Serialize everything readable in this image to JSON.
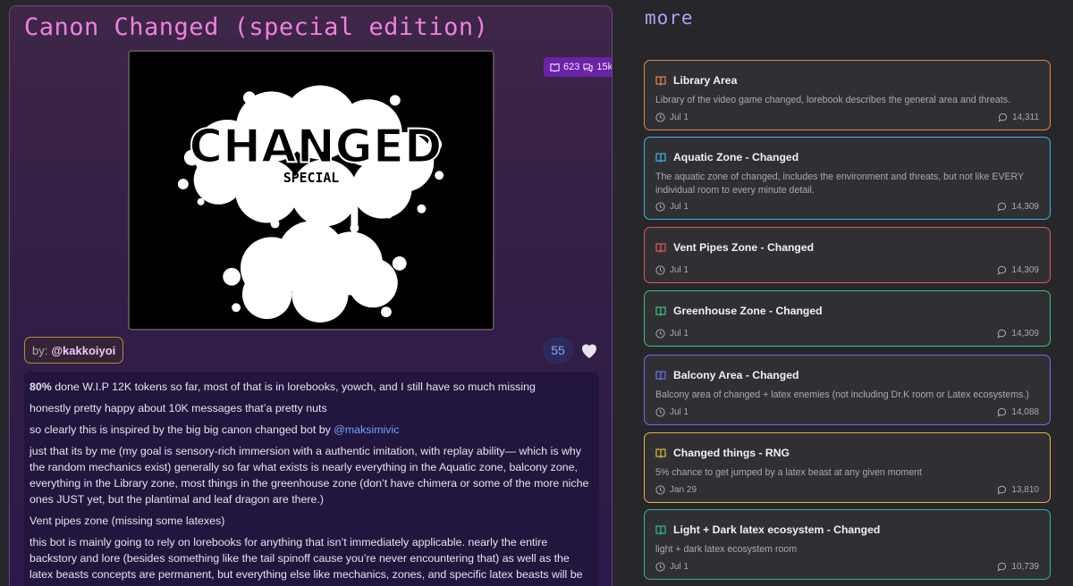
{
  "bot": {
    "title": "Canon Changed (special edition)",
    "stats": {
      "books": "623",
      "chats": "15k"
    },
    "image": {
      "main_word": "CHANGED",
      "sub_word": "SPECIAL"
    },
    "author": {
      "prefix": "by:",
      "handle": "@kakkoiyoi"
    },
    "likes": "55",
    "description": {
      "p1_bold": "80%",
      "p1_rest": " done W.I.P 12K tokens so far, most of that is in lorebooks, yowch, and I still have so much missing",
      "p2": "honestly pretty happy about 10K messages that’a pretty nuts",
      "p3_pre": "so clearly this is inspired by the big big canon changed bot by ",
      "p3_mention": "@maksimivic",
      "p4": "just that its by me (my goal is sensory-rich immersion with a authentic imitation, with replay ability— which is why the random mechanics exist) generally so far what exists is nearly everything in the Aquatic zone, balcony zone, everything in the Library zone, most things in the greenhouse zone (don’t have chimera or some of the more niche ones JUST yet, but the plantimal and leaf dragon are there.)",
      "p5": "Vent pipes zone (missing some latexes)",
      "p6": "this bot is mainly going to rely on lorebooks for anything that isn’t immediately applicable. nearly the entire backstory and lore (besides something like the tail spinoff cause you’re never encountering that) as well as the latex beasts concepts are permanent, but everything else like mechanics, zones, and specific latex beasts will be lorebooks."
    }
  },
  "more": {
    "heading": "more",
    "items": [
      {
        "title": "Library Area",
        "desc": "Library of the video game changed, lorebook describes the general area and threats.",
        "date": "Jul 1",
        "count": "14,311",
        "color": "#e8873a"
      },
      {
        "title": "Aquatic Zone - Changed",
        "desc": "The aquatic zone of changed, includes the environment and threats, but not like EVERY individual room to every minute detail.",
        "date": "Jul 1",
        "count": "14,309",
        "color": "#3ab4e0"
      },
      {
        "title": "Vent Pipes Zone - Changed",
        "desc": "",
        "date": "Jul 1",
        "count": "14,309",
        "color": "#e05555"
      },
      {
        "title": "Greenhouse Zone - Changed",
        "desc": "",
        "date": "Jul 1",
        "count": "14,309",
        "color": "#3fc27a"
      },
      {
        "title": "Balcony Area - Changed",
        "desc": "Balcony area of changed + latex enemies (not including Dr.K room or Latex ecosystems.)",
        "date": "Jul 1",
        "count": "14,088",
        "color": "#6b6ee8"
      },
      {
        "title": "Changed things - RNG",
        "desc": "5% chance to get jumped by a latex beast at any given moment",
        "date": "Jan 29",
        "count": "13,810",
        "color": "#e3b341"
      },
      {
        "title": "Light + Dark latex ecosystem - Changed",
        "desc": "light + dark latex ecosystem room",
        "date": "Jul 1",
        "count": "10,739",
        "color": "#2fb3a0"
      }
    ]
  }
}
